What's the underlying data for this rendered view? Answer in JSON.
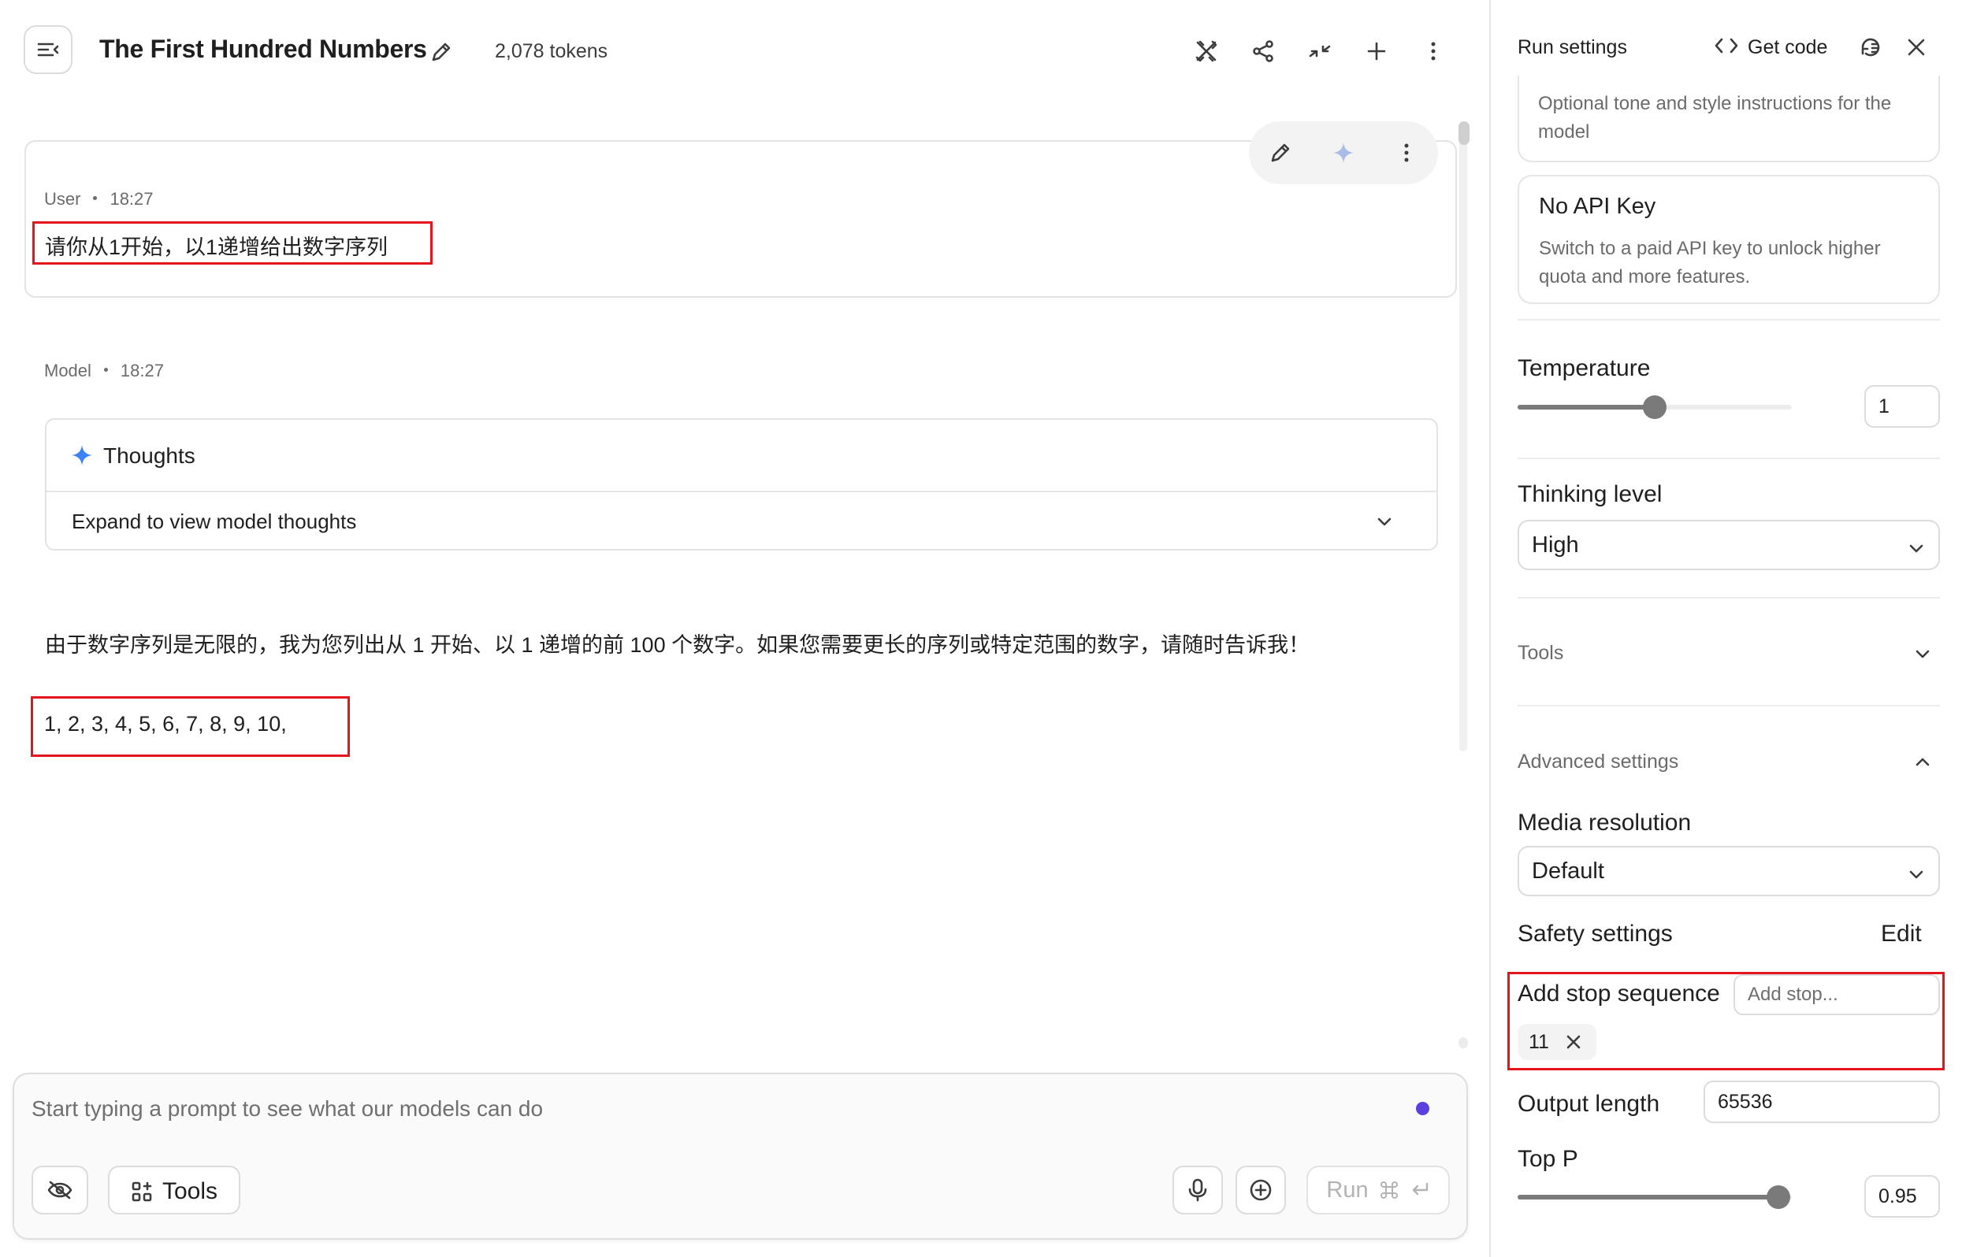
{
  "header": {
    "title": "The First Hundred Numbers",
    "tokens": "2,078 tokens"
  },
  "messages": {
    "user": {
      "role": "User",
      "time": "18:27",
      "text": "请你从1开始，以1递增给出数字序列"
    },
    "model": {
      "role": "Model",
      "time": "18:27",
      "thoughts_title": "Thoughts",
      "thoughts_expand": "Expand to view model thoughts",
      "text": "由于数字序列是无限的，我为您列出从 1 开始、以 1 递增的前 100 个数字。如果您需要更长的序列或特定范围的数字，请随时告诉我！",
      "numbers": "1, 2, 3, 4, 5, 6, 7, 8, 9, 10,"
    }
  },
  "prompt": {
    "placeholder": "Start typing a prompt to see what our models can do",
    "tools_label": "Tools",
    "run_label": "Run"
  },
  "run_settings": {
    "title": "Run settings",
    "get_code": "Get code",
    "system_instructions_desc": "Optional tone and style instructions for the model",
    "api_key": {
      "title": "No API Key",
      "desc": "Switch to a paid API key to unlock higher quota and more features."
    },
    "temperature": {
      "label": "Temperature",
      "value": "1",
      "level": 0.5
    },
    "thinking_level": {
      "label": "Thinking level",
      "value": "High"
    },
    "tools_label": "Tools",
    "advanced_label": "Advanced settings",
    "media_resolution": {
      "label": "Media resolution",
      "value": "Default"
    },
    "safety": {
      "label": "Safety settings",
      "edit": "Edit"
    },
    "stop_sequence": {
      "label": "Add stop sequence",
      "placeholder": "Add stop...",
      "chips": [
        "11"
      ]
    },
    "output_length": {
      "label": "Output length",
      "value": "65536"
    },
    "top_p": {
      "label": "Top P",
      "value": "0.95",
      "level": 0.95
    }
  },
  "colors": {
    "accent_purple": "#5b3fe0",
    "highlight_red": "#e3141b",
    "sparkle_blue": "#3b82f6"
  }
}
